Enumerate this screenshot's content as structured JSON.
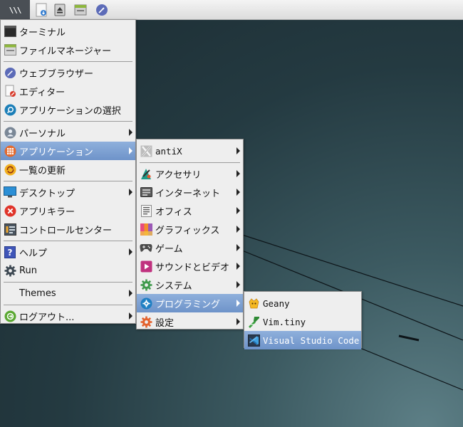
{
  "taskbar": {
    "menu_glyph": "\\\\\\",
    "buttons": [
      "menu-button",
      "file-manager",
      "eject",
      "terminal-window",
      "web-browser"
    ]
  },
  "main_menu": {
    "items": [
      {
        "label": "ターミナル",
        "icon": "terminal-icon",
        "submenu": false
      },
      {
        "label": "ファイルマネージャー",
        "icon": "file-manager-icon",
        "submenu": false
      },
      {
        "label": "ウェブブラウザー",
        "icon": "browser-icon",
        "submenu": false
      },
      {
        "label": "エディター",
        "icon": "editor-icon",
        "submenu": false
      },
      {
        "label": "アプリケーションの選択",
        "icon": "app-finder-icon",
        "submenu": false
      },
      {
        "label": "パーソナル",
        "icon": "personal-icon",
        "submenu": true
      },
      {
        "label": "アプリケーション",
        "icon": "applications-icon",
        "submenu": true,
        "active": true
      },
      {
        "label": "一覧の更新",
        "icon": "refresh-icon",
        "submenu": false
      },
      {
        "label": "デスクトップ",
        "icon": "desktop-icon",
        "submenu": true
      },
      {
        "label": "アプリキラー",
        "icon": "app-killer-icon",
        "submenu": false
      },
      {
        "label": "コントロールセンター",
        "icon": "control-centre-icon",
        "submenu": false
      },
      {
        "label": "ヘルプ",
        "icon": "help-icon",
        "submenu": true
      },
      {
        "label": "Run",
        "icon": "gear-icon",
        "submenu": false
      },
      {
        "label": "Themes",
        "icon": "",
        "submenu": true
      },
      {
        "label": "ログアウト...",
        "icon": "logout-icon",
        "submenu": true
      }
    ]
  },
  "applications_menu": {
    "items": [
      {
        "label": "antiX",
        "icon": "antix-icon",
        "submenu": true
      },
      {
        "label": "アクセサリ",
        "icon": "accessories-icon",
        "submenu": true
      },
      {
        "label": "インターネット",
        "icon": "internet-icon",
        "submenu": true
      },
      {
        "label": "オフィス",
        "icon": "office-icon",
        "submenu": true
      },
      {
        "label": "グラフィックス",
        "icon": "graphics-icon",
        "submenu": true
      },
      {
        "label": "ゲーム",
        "icon": "games-icon",
        "submenu": true
      },
      {
        "label": "サウンドとビデオ",
        "icon": "multimedia-icon",
        "submenu": true
      },
      {
        "label": "システム",
        "icon": "system-icon",
        "submenu": true
      },
      {
        "label": "プログラミング",
        "icon": "programming-icon",
        "submenu": true,
        "active": true
      },
      {
        "label": "設定",
        "icon": "settings-icon",
        "submenu": true
      }
    ]
  },
  "programming_menu": {
    "items": [
      {
        "label": "Geany",
        "icon": "geany-icon"
      },
      {
        "label": "Vim.tiny",
        "icon": "vim-icon"
      },
      {
        "label": "Visual Studio Code",
        "icon": "vscode-icon",
        "active": true
      }
    ]
  },
  "colors": {
    "highlight": "#7b9ed0",
    "menu_bg": "#eeeeee",
    "taskbar_bg": "#e6e6e6"
  }
}
